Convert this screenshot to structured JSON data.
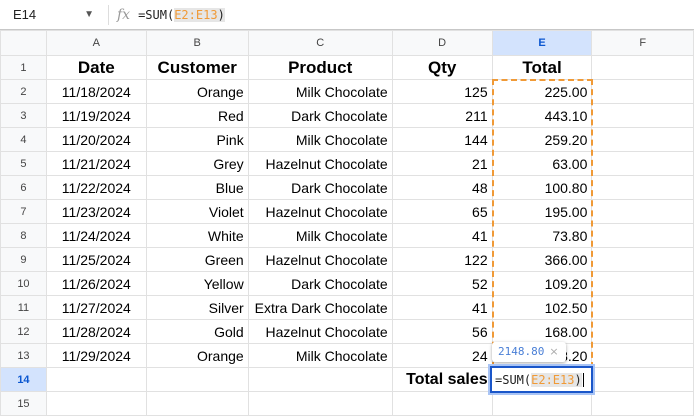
{
  "formula_bar": {
    "cell_ref": "E14",
    "formula_prefix": "=SUM(",
    "formula_range": "E2:E13",
    "formula_suffix": ")"
  },
  "columns": [
    "A",
    "B",
    "C",
    "D",
    "E",
    "F"
  ],
  "headers": [
    "Date",
    "Customer",
    "Product",
    "Qty",
    "Total"
  ],
  "rows": [
    [
      "11/18/2024",
      "Orange",
      "Milk Chocolate",
      "125",
      "225.00"
    ],
    [
      "11/19/2024",
      "Red",
      "Dark Chocolate",
      "211",
      "443.10"
    ],
    [
      "11/20/2024",
      "Pink",
      "Milk Chocolate",
      "144",
      "259.20"
    ],
    [
      "11/21/2024",
      "Grey",
      "Hazelnut Chocolate",
      "21",
      "63.00"
    ],
    [
      "11/22/2024",
      "Blue",
      "Dark Chocolate",
      "48",
      "100.80"
    ],
    [
      "11/23/2024",
      "Violet",
      "Hazelnut Chocolate",
      "65",
      "195.00"
    ],
    [
      "11/24/2024",
      "White",
      "Milk Chocolate",
      "41",
      "73.80"
    ],
    [
      "11/25/2024",
      "Green",
      "Hazelnut Chocolate",
      "122",
      "366.00"
    ],
    [
      "11/26/2024",
      "Yellow",
      "Dark Chocolate",
      "52",
      "109.20"
    ],
    [
      "11/27/2024",
      "Silver",
      "Extra Dark Chocolate",
      "41",
      "102.50"
    ],
    [
      "11/28/2024",
      "Gold",
      "Hazelnut Chocolate",
      "56",
      "168.00"
    ],
    [
      "11/29/2024",
      "Orange",
      "Milk Chocolate",
      "24",
      "43.20"
    ]
  ],
  "total_label": "Total sales",
  "tooltip_value": "2148.80",
  "tooltip_close": "×",
  "colors": {
    "range": "#f09a37",
    "selection": "#1a56c9"
  }
}
